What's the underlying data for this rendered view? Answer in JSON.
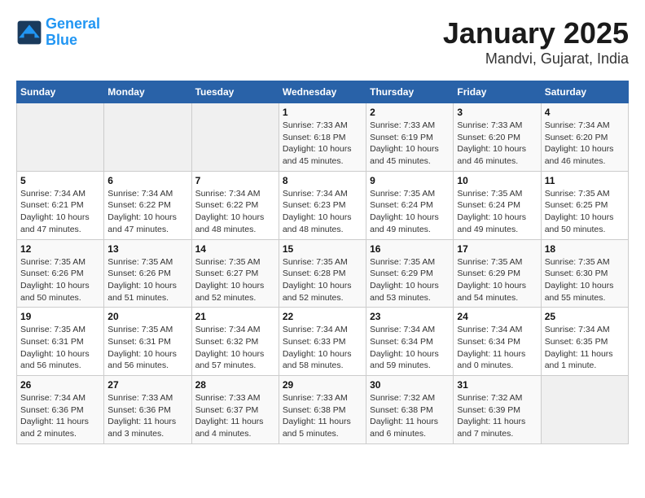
{
  "header": {
    "logo_line1": "General",
    "logo_line2": "Blue",
    "title": "January 2025",
    "subtitle": "Mandvi, Gujarat, India"
  },
  "weekdays": [
    "Sunday",
    "Monday",
    "Tuesday",
    "Wednesday",
    "Thursday",
    "Friday",
    "Saturday"
  ],
  "weeks": [
    [
      {
        "day": "",
        "info": ""
      },
      {
        "day": "",
        "info": ""
      },
      {
        "day": "",
        "info": ""
      },
      {
        "day": "1",
        "info": "Sunrise: 7:33 AM\nSunset: 6:18 PM\nDaylight: 10 hours and 45 minutes."
      },
      {
        "day": "2",
        "info": "Sunrise: 7:33 AM\nSunset: 6:19 PM\nDaylight: 10 hours and 45 minutes."
      },
      {
        "day": "3",
        "info": "Sunrise: 7:33 AM\nSunset: 6:20 PM\nDaylight: 10 hours and 46 minutes."
      },
      {
        "day": "4",
        "info": "Sunrise: 7:34 AM\nSunset: 6:20 PM\nDaylight: 10 hours and 46 minutes."
      }
    ],
    [
      {
        "day": "5",
        "info": "Sunrise: 7:34 AM\nSunset: 6:21 PM\nDaylight: 10 hours and 47 minutes."
      },
      {
        "day": "6",
        "info": "Sunrise: 7:34 AM\nSunset: 6:22 PM\nDaylight: 10 hours and 47 minutes."
      },
      {
        "day": "7",
        "info": "Sunrise: 7:34 AM\nSunset: 6:22 PM\nDaylight: 10 hours and 48 minutes."
      },
      {
        "day": "8",
        "info": "Sunrise: 7:34 AM\nSunset: 6:23 PM\nDaylight: 10 hours and 48 minutes."
      },
      {
        "day": "9",
        "info": "Sunrise: 7:35 AM\nSunset: 6:24 PM\nDaylight: 10 hours and 49 minutes."
      },
      {
        "day": "10",
        "info": "Sunrise: 7:35 AM\nSunset: 6:24 PM\nDaylight: 10 hours and 49 minutes."
      },
      {
        "day": "11",
        "info": "Sunrise: 7:35 AM\nSunset: 6:25 PM\nDaylight: 10 hours and 50 minutes."
      }
    ],
    [
      {
        "day": "12",
        "info": "Sunrise: 7:35 AM\nSunset: 6:26 PM\nDaylight: 10 hours and 50 minutes."
      },
      {
        "day": "13",
        "info": "Sunrise: 7:35 AM\nSunset: 6:26 PM\nDaylight: 10 hours and 51 minutes."
      },
      {
        "day": "14",
        "info": "Sunrise: 7:35 AM\nSunset: 6:27 PM\nDaylight: 10 hours and 52 minutes."
      },
      {
        "day": "15",
        "info": "Sunrise: 7:35 AM\nSunset: 6:28 PM\nDaylight: 10 hours and 52 minutes."
      },
      {
        "day": "16",
        "info": "Sunrise: 7:35 AM\nSunset: 6:29 PM\nDaylight: 10 hours and 53 minutes."
      },
      {
        "day": "17",
        "info": "Sunrise: 7:35 AM\nSunset: 6:29 PM\nDaylight: 10 hours and 54 minutes."
      },
      {
        "day": "18",
        "info": "Sunrise: 7:35 AM\nSunset: 6:30 PM\nDaylight: 10 hours and 55 minutes."
      }
    ],
    [
      {
        "day": "19",
        "info": "Sunrise: 7:35 AM\nSunset: 6:31 PM\nDaylight: 10 hours and 56 minutes."
      },
      {
        "day": "20",
        "info": "Sunrise: 7:35 AM\nSunset: 6:31 PM\nDaylight: 10 hours and 56 minutes."
      },
      {
        "day": "21",
        "info": "Sunrise: 7:34 AM\nSunset: 6:32 PM\nDaylight: 10 hours and 57 minutes."
      },
      {
        "day": "22",
        "info": "Sunrise: 7:34 AM\nSunset: 6:33 PM\nDaylight: 10 hours and 58 minutes."
      },
      {
        "day": "23",
        "info": "Sunrise: 7:34 AM\nSunset: 6:34 PM\nDaylight: 10 hours and 59 minutes."
      },
      {
        "day": "24",
        "info": "Sunrise: 7:34 AM\nSunset: 6:34 PM\nDaylight: 11 hours and 0 minutes."
      },
      {
        "day": "25",
        "info": "Sunrise: 7:34 AM\nSunset: 6:35 PM\nDaylight: 11 hours and 1 minute."
      }
    ],
    [
      {
        "day": "26",
        "info": "Sunrise: 7:34 AM\nSunset: 6:36 PM\nDaylight: 11 hours and 2 minutes."
      },
      {
        "day": "27",
        "info": "Sunrise: 7:33 AM\nSunset: 6:36 PM\nDaylight: 11 hours and 3 minutes."
      },
      {
        "day": "28",
        "info": "Sunrise: 7:33 AM\nSunset: 6:37 PM\nDaylight: 11 hours and 4 minutes."
      },
      {
        "day": "29",
        "info": "Sunrise: 7:33 AM\nSunset: 6:38 PM\nDaylight: 11 hours and 5 minutes."
      },
      {
        "day": "30",
        "info": "Sunrise: 7:32 AM\nSunset: 6:38 PM\nDaylight: 11 hours and 6 minutes."
      },
      {
        "day": "31",
        "info": "Sunrise: 7:32 AM\nSunset: 6:39 PM\nDaylight: 11 hours and 7 minutes."
      },
      {
        "day": "",
        "info": ""
      }
    ]
  ]
}
